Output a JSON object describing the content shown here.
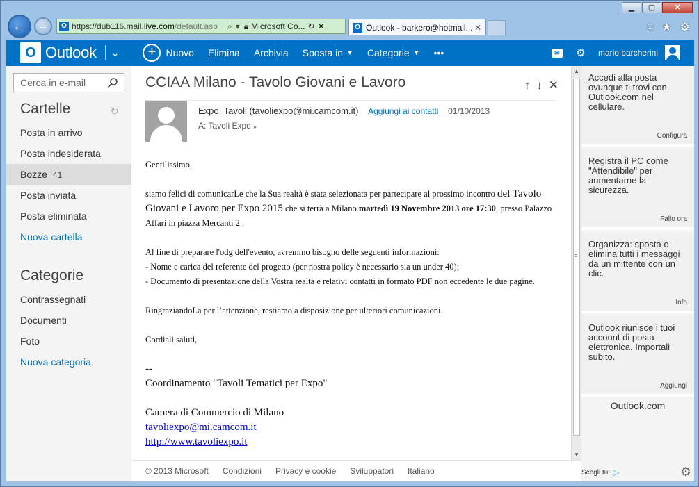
{
  "browser": {
    "url_host_pre": "https://dub116.mail.",
    "url_host_main": "live.com",
    "url_path": "/default.asp",
    "cert_label": "Microsoft Co...",
    "tab_title": "Outlook - barkero@hotmail...",
    "window_buttons": {
      "minimize": "▁",
      "maximize": "▢",
      "close": "✕"
    }
  },
  "topbar": {
    "logo_letter": "O",
    "logo_text": "Outlook",
    "commands": {
      "new": "Nuovo",
      "delete": "Elimina",
      "archive": "Archivia",
      "move_to": "Sposta in",
      "categories": "Categorie",
      "more": "•••"
    },
    "user_name": "mario barcherini"
  },
  "sidebar": {
    "search_placeholder": "Cerca in e-mail",
    "folders_title": "Cartelle",
    "folders": [
      {
        "label": "Posta in arrivo"
      },
      {
        "label": "Posta indesiderata"
      },
      {
        "label": "Bozze",
        "count": "41"
      },
      {
        "label": "Posta inviata"
      },
      {
        "label": "Posta eliminata"
      }
    ],
    "new_folder": "Nuova cartella",
    "categories_title": "Categorie",
    "categories": [
      {
        "label": "Contrassegnati"
      },
      {
        "label": "Documenti"
      },
      {
        "label": "Foto"
      }
    ],
    "new_category": "Nuova categoria"
  },
  "message": {
    "subject": "CCIAA Milano - Tavolo Giovani e Lavoro",
    "sender_name": "Expo, Tavoli",
    "sender_email": "(tavoliexpo@mi.camcom.it)",
    "add_contact": "Aggiungi ai contatti",
    "date": "01/10/2013",
    "to": "A: Tavoli Expo",
    "body": {
      "greeting": "Gentilissimo,",
      "p1_a": "siamo felici di comunicarLe che la Sua realtà è stata selezionata per partecipare al prossimo incontro ",
      "p1_b": "del Tavolo Giovani e Lavoro per Expo 2015",
      "p1_c": " che si terrà a Milano ",
      "p1_d": "martedì 19  Novembre 2013 ore 17:30",
      "p1_e": ", presso Palazzo Affari in piazza Mercanti 2 .",
      "p2_intro": "Al fine di preparare l'odg dell'evento, avremmo bisogno delle seguenti informazioni:",
      "p2_item1": "- Nome e carica del referente del progetto (per nostra policy è necessario sia un under 40);",
      "p2_item2": "- Documento di presentazione della Vostra realtà e relativi contatti in formato PDF non eccedente le due pagine.",
      "p3": "RingraziandoLa per l’attenzione, restiamo a disposizione per ulteriori comunicazioni.",
      "closing": "Cordiali saluti,",
      "sig_sep": "--",
      "sig_line1": "Coordinamento \"Tavoli Tematici per Expo\"",
      "sig_line2": "Camera di Commercio di Milano",
      "sig_email": "tavoliexpo@mi.camcom.it",
      "sig_web": "http://www.tavoliexpo.it"
    }
  },
  "footer": {
    "copyright": "© 2013 Microsoft",
    "terms": "Condizioni",
    "privacy": "Privacy e cookie",
    "developers": "Sviluppatori",
    "language": "Italiano"
  },
  "right_pane": {
    "cards": [
      {
        "text": "Accedi alla posta ovunque ti trovi con Outlook.com nel cellulare.",
        "link": "Configura"
      },
      {
        "text": "Registra il PC come \"Attendibile\" per aumentarne la sicurezza.",
        "link": "Fallo ora"
      },
      {
        "text": "Organizza: sposta o elimina tutti i messaggi da un mittente con un clic.",
        "link": "Info"
      },
      {
        "text": "Outlook riunisce i tuoi account di posta elettronica. Importali subito.",
        "link": "Aggiungi"
      }
    ],
    "brand": "Outlook.com",
    "ad_choice": "Scegli tu!"
  },
  "colors": {
    "brand_blue": "#0072c6",
    "address_bar_green": "#cfeecf",
    "selected_folder": "#dcdcdc"
  }
}
